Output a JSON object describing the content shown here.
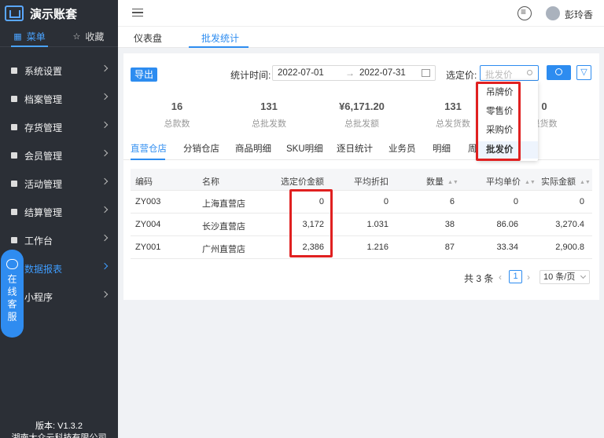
{
  "sidebar": {
    "title": "演示账套",
    "tabs": [
      {
        "label": "菜单"
      },
      {
        "label": "收藏"
      }
    ],
    "items": [
      {
        "label": "系统设置"
      },
      {
        "label": "档案管理"
      },
      {
        "label": "存货管理"
      },
      {
        "label": "会员管理"
      },
      {
        "label": "活动管理"
      },
      {
        "label": "结算管理"
      },
      {
        "label": "工作台"
      },
      {
        "label": "数据报表"
      },
      {
        "label": "小程序"
      }
    ],
    "version": "版本: V1.3.2",
    "company": "湖南大众云科技有限公司"
  },
  "chat": {
    "label": "在线客服"
  },
  "topbar": {
    "username": "彭玲香"
  },
  "page_tabs": [
    {
      "label": "仪表盘"
    },
    {
      "label": "批发统计"
    }
  ],
  "filters": {
    "export_label": "导出",
    "date_label": "统计时间:",
    "date_start": "2022-07-01",
    "date_sep": "→",
    "date_end": "2022-07-31",
    "price_label": "选定价:",
    "price_placeholder": "批发价"
  },
  "stats": [
    {
      "value": "16",
      "label": "总款数"
    },
    {
      "value": "131",
      "label": "总批发数"
    },
    {
      "value": "¥6,171.20",
      "label": "总批发额"
    },
    {
      "value": "131",
      "label": "总发货数"
    },
    {
      "value": "0",
      "label": "退货数"
    }
  ],
  "sub_tabs": [
    "直营仓店",
    "分销仓店",
    "商品明细",
    "SKU明细",
    "逐日统计",
    "业务员",
    "明细",
    "周"
  ],
  "table": {
    "headers": [
      "编码",
      "名称",
      "选定价金额",
      "平均折扣",
      "数量",
      "平均单价",
      "实际金额"
    ],
    "rows": [
      [
        "ZY003",
        "上海直营店",
        "0",
        "0",
        "6",
        "0",
        "0"
      ],
      [
        "ZY004",
        "长沙直营店",
        "3,172",
        "1.031",
        "38",
        "86.06",
        "3,270.4"
      ],
      [
        "ZY001",
        "广州直营店",
        "2,386",
        "1.216",
        "87",
        "33.34",
        "2,900.8"
      ]
    ]
  },
  "pagination": {
    "total": "共 3 条",
    "current": "1",
    "page_size": "10 条/页"
  },
  "price_dropdown": {
    "options": [
      "吊牌价",
      "零售价",
      "采购价",
      "批发价"
    ],
    "selected": "批发价"
  },
  "colors": {
    "accent": "#2d8cf0",
    "sidebar_bg": "#2b2f36",
    "highlight": "#e02020"
  }
}
